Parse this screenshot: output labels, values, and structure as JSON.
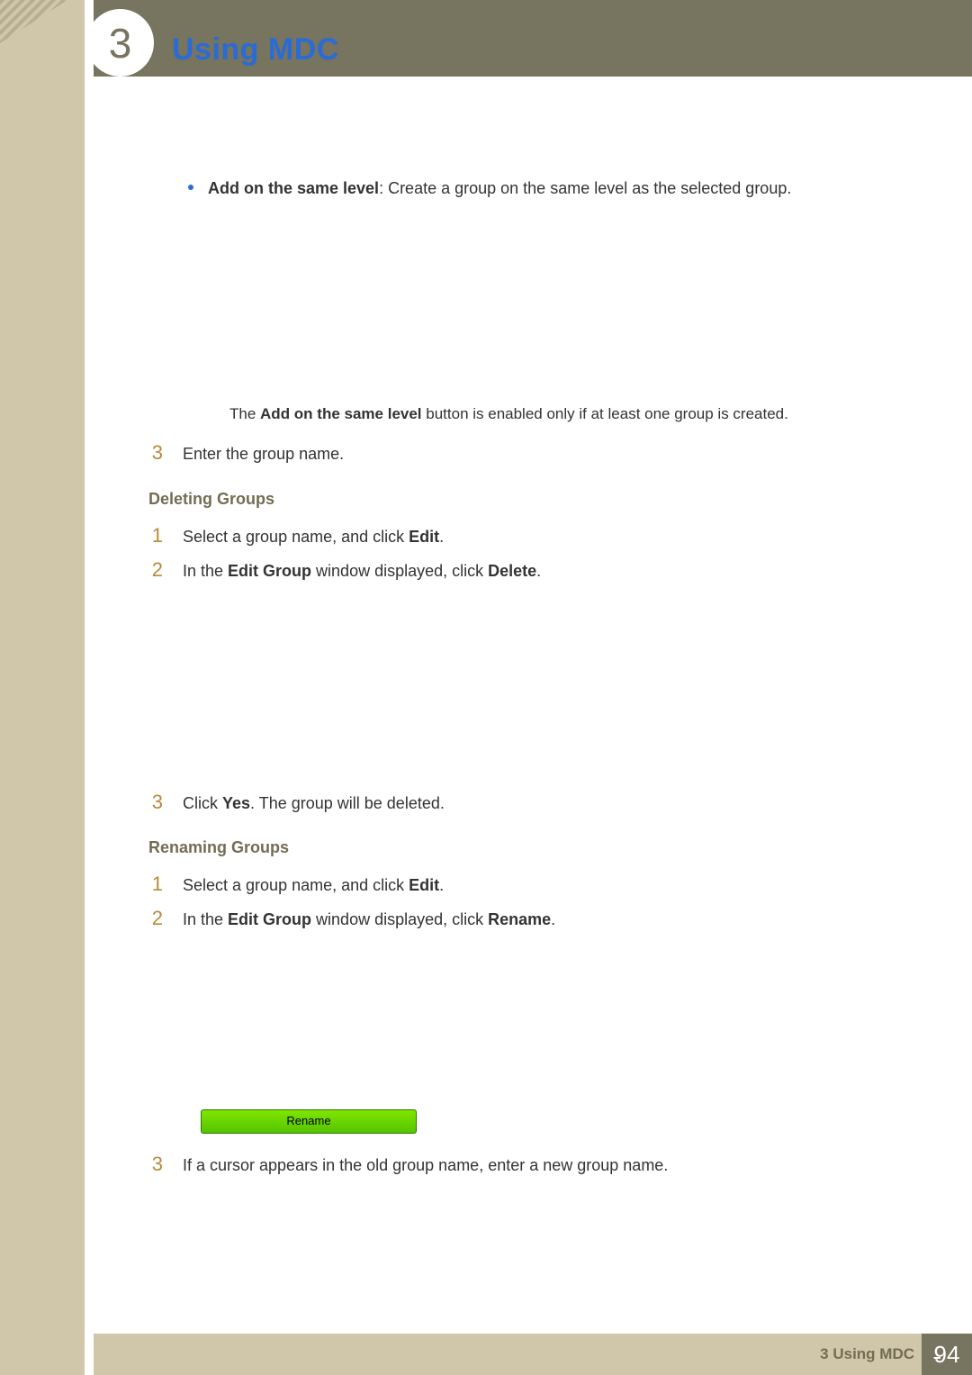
{
  "header": {
    "chapter_number": "3",
    "page_title": "Using MDC"
  },
  "content": {
    "bullet1": {
      "label": "Add on the same level",
      "text": ": Create a group on the same level as the selected group."
    },
    "note1": {
      "prefix": "The ",
      "bold": "Add on the same level",
      "suffix": " button is enabled only if at least one group is created."
    },
    "step_enter": {
      "num": "3",
      "text": "Enter the group name."
    },
    "sub_deleting": "Deleting Groups",
    "del_s1": {
      "num": "1",
      "prefix": "Select a group name, and click ",
      "bold": "Edit",
      "suffix": "."
    },
    "del_s2": {
      "num": "2",
      "prefix": "In the ",
      "bold1": "Edit Group",
      "mid": " window displayed, click ",
      "bold2": "Delete",
      "suffix": "."
    },
    "del_s3": {
      "num": "3",
      "prefix": "Click ",
      "bold": "Yes",
      "suffix": ". The group will be deleted."
    },
    "sub_renaming": "Renaming Groups",
    "ren_s1": {
      "num": "1",
      "prefix": "Select a group name, and click ",
      "bold": "Edit",
      "suffix": "."
    },
    "ren_s2": {
      "num": "2",
      "prefix": "In the ",
      "bold1": "Edit Group",
      "mid": " window displayed, click ",
      "bold2": "Rename",
      "suffix": "."
    },
    "rename_button_label": "Rename",
    "ren_s3": {
      "num": "3",
      "text": "If a cursor appears in the old group name, enter a new group name."
    }
  },
  "footer": {
    "label": "3 Using MDC",
    "page_number": "94"
  }
}
